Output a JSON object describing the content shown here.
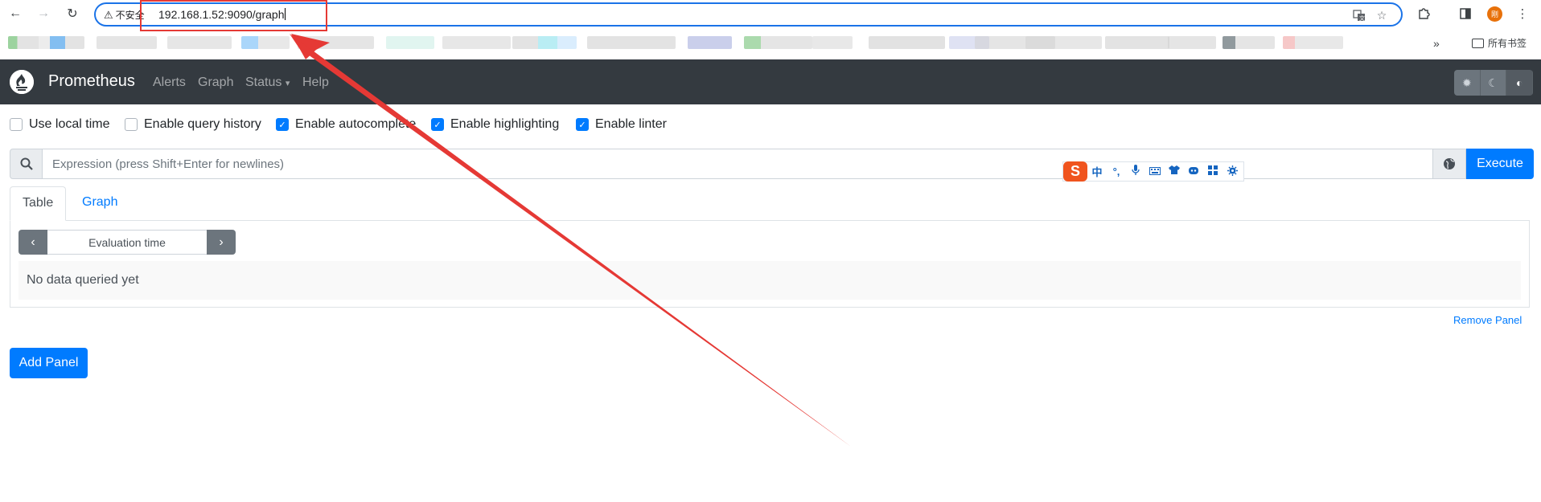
{
  "browser": {
    "back_icon": "arrow-left-icon",
    "forward_icon": "arrow-right-icon",
    "reload_icon": "reload-icon",
    "security_label": "不安全",
    "url": "192.168.1.52:9090/graph",
    "translate_icon": "translate-icon",
    "star_icon": "star-icon",
    "extensions_icon": "puzzle-icon",
    "sidebar_icon": "sidebar-icon",
    "profile_initial": "刚",
    "menu_icon": "kebab-menu-icon",
    "bookmarks_more": "»",
    "all_bookmarks_label": "所有书签"
  },
  "navbar": {
    "brand": "Prometheus",
    "links": [
      "Alerts",
      "Graph",
      "Status",
      "Help"
    ],
    "status_caret": "▾",
    "theme_buttons": [
      "light-theme-icon",
      "dark-theme-icon",
      "auto-theme-icon"
    ]
  },
  "options": {
    "items": [
      {
        "label": "Use local time",
        "checked": false
      },
      {
        "label": "Enable query history",
        "checked": false
      },
      {
        "label": "Enable autocomplete",
        "checked": true
      },
      {
        "label": "Enable highlighting",
        "checked": true
      },
      {
        "label": "Enable linter",
        "checked": true
      }
    ]
  },
  "expression": {
    "placeholder": "Expression (press Shift+Enter for newlines)",
    "execute_label": "Execute",
    "search_icon": "search-icon",
    "metrics_icon": "globe-icon"
  },
  "ime_toolbar": {
    "logo": "S",
    "items": [
      "中",
      "°,",
      "🎤",
      "⌨",
      "👕",
      "☺",
      "▦",
      "✲"
    ]
  },
  "panel": {
    "tabs": [
      "Table",
      "Graph"
    ],
    "eval_placeholder": "Evaluation time",
    "prev_label": "‹",
    "next_label": "›",
    "empty_message": "No data queried yet",
    "remove_label": "Remove Panel"
  },
  "add_panel_label": "Add Panel",
  "colors": {
    "primary": "#007bff",
    "navbar_bg": "#343a40",
    "annotation_red": "#e53935"
  }
}
